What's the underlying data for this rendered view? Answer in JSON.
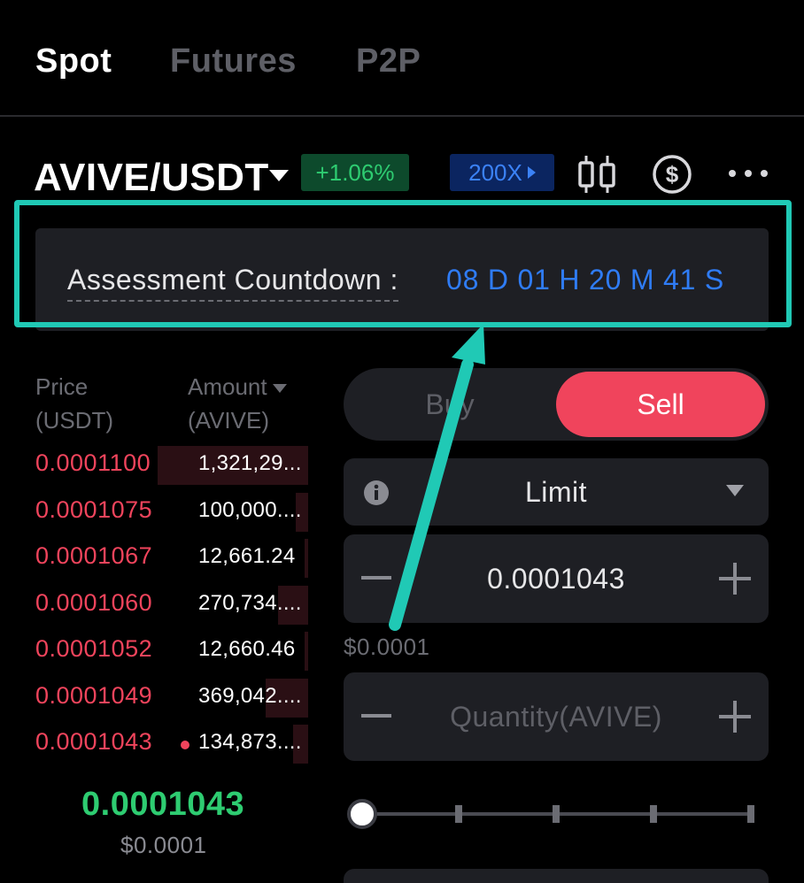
{
  "tabs": [
    {
      "label": "Spot",
      "active": true
    },
    {
      "label": "Futures",
      "active": false
    },
    {
      "label": "P2P",
      "active": false
    }
  ],
  "pair": {
    "name": "AVIVE/USDT",
    "change": "+1.06%",
    "leverage": "200X",
    "icons": [
      "candlestick-chart-icon",
      "dollar-circle-icon",
      "more-icon"
    ]
  },
  "assessment": {
    "label": "Assessment Countdown :",
    "value": "08 D 01 H 20 M 41 S"
  },
  "orderbook": {
    "price_header": "Price",
    "price_unit": "(USDT)",
    "amount_header": "Amount",
    "amount_unit": "(AVIVE)",
    "asks": [
      {
        "price": "0.0001100",
        "amount": "1,321,29...",
        "depth": 1.0
      },
      {
        "price": "0.0001075",
        "amount": "100,000....",
        "depth": 0.08
      },
      {
        "price": "0.0001067",
        "amount": "12,661.24",
        "depth": 0.01
      },
      {
        "price": "0.0001060",
        "amount": "270,734....",
        "depth": 0.2
      },
      {
        "price": "0.0001052",
        "amount": "12,660.46",
        "depth": 0.01
      },
      {
        "price": "0.0001049",
        "amount": "369,042....",
        "depth": 0.28
      },
      {
        "price": "0.0001043",
        "amount": "134,873....",
        "depth": 0.1
      }
    ],
    "last_price": "0.0001043",
    "last_price_usd": "$0.0001"
  },
  "trade": {
    "buy_label": "Buy",
    "sell_label": "Sell",
    "order_type": "Limit",
    "price_value": "0.0001043",
    "price_usd": "$0.0001",
    "quantity_placeholder": "Quantity(AVIVE)",
    "slider_percent": 0
  },
  "colors": {
    "sell": "#f0445c",
    "buy": "#2ecc71",
    "accent_blue": "#2f7cf6",
    "highlight": "#20c9b5"
  }
}
